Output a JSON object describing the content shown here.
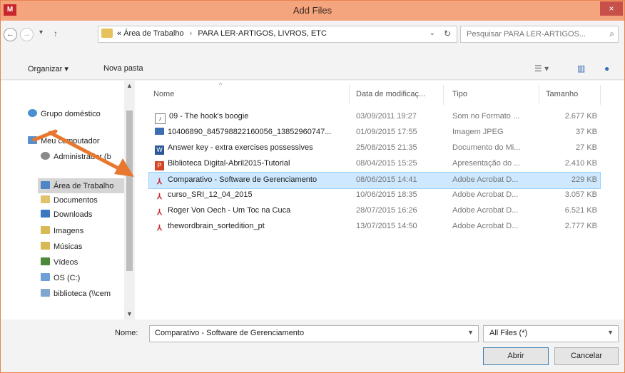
{
  "window": {
    "title": "Add Files",
    "app_icon_text": "M",
    "close_symbol": "×",
    "accent_color": "#e9834f"
  },
  "address": {
    "back_symbol": "←",
    "forward_symbol": "→",
    "up_symbol": "↑",
    "crumb_prefix": "«",
    "crumbs": [
      "Área de Trabalho",
      "PARA LER-ARTIGOS, LIVROS, ETC"
    ],
    "crumb_separator": "›",
    "search_placeholder": "Pesquisar PARA LER-ARTIGOS..."
  },
  "toolbar": {
    "organize_label": "Organizar ▾",
    "new_folder_label": "Nova pasta"
  },
  "nav_pane": {
    "items": [
      {
        "label": "Grupo doméstico",
        "icon": "homegroup-icon"
      },
      {
        "label": "Meu computador",
        "icon": "computer-icon"
      },
      {
        "label": "Administrador (b",
        "icon": "user-folder-icon"
      },
      {
        "label": "Área de Trabalho",
        "icon": "desktop-folder-icon"
      },
      {
        "label": "Documentos",
        "icon": "documents-folder-icon"
      },
      {
        "label": "Downloads",
        "icon": "downloads-folder-icon"
      },
      {
        "label": "Imagens",
        "icon": "pictures-folder-icon"
      },
      {
        "label": "Músicas",
        "icon": "music-folder-icon"
      },
      {
        "label": "Vídeos",
        "icon": "videos-folder-icon"
      },
      {
        "label": "OS (C:)",
        "icon": "drive-icon"
      },
      {
        "label": "biblioteca (\\\\cem",
        "icon": "network-drive-icon"
      }
    ],
    "selected": "Área de Trabalho"
  },
  "file_list": {
    "columns": {
      "name": "Nome",
      "date": "Data de modificaç...",
      "type": "Tipo",
      "size": "Tamanho"
    },
    "rows": [
      {
        "name": "09 - The hook's boogie",
        "date": "03/09/2011 19:27",
        "type": "Som no Formato ...",
        "size": "2.677 KB",
        "icon": "audio-file-icon",
        "selected": false
      },
      {
        "name": "10406890_845798822160056_13852960747...",
        "date": "01/09/2015 17:55",
        "type": "Imagem JPEG",
        "size": "37 KB",
        "icon": "jpeg-file-icon",
        "selected": false
      },
      {
        "name": "Answer key - extra exercises possessives",
        "date": "25/08/2015 21:35",
        "type": "Documento do Mi...",
        "size": "27 KB",
        "icon": "word-file-icon",
        "selected": false
      },
      {
        "name": "Biblioteca Digital-Abril2015-Tutorial",
        "date": "08/04/2015 15:25",
        "type": "Apresentação do ...",
        "size": "2.410 KB",
        "icon": "powerpoint-file-icon",
        "selected": false
      },
      {
        "name": "Comparativo - Software de Gerenciamento",
        "date": "08/06/2015 14:41",
        "type": "Adobe Acrobat D...",
        "size": "229 KB",
        "icon": "pdf-file-icon",
        "selected": true
      },
      {
        "name": "curso_SRI_12_04_2015",
        "date": "10/06/2015 18:35",
        "type": "Adobe Acrobat D...",
        "size": "3.057 KB",
        "icon": "pdf-file-icon",
        "selected": false
      },
      {
        "name": "Roger Von Oech - Um Toc na Cuca",
        "date": "28/07/2015 16:26",
        "type": "Adobe Acrobat D...",
        "size": "6.521 KB",
        "icon": "pdf-file-icon",
        "selected": false
      },
      {
        "name": "thewordbrain_sortedition_pt",
        "date": "13/07/2015 14:50",
        "type": "Adobe Acrobat D...",
        "size": "2.777 KB",
        "icon": "pdf-file-icon",
        "selected": false
      }
    ]
  },
  "bottom": {
    "filename_label": "Nome:",
    "filename_value": "Comparativo - Software de Gerenciamento",
    "filter_value": "All Files (*)",
    "open_label": "Abrir",
    "cancel_label": "Cancelar"
  }
}
